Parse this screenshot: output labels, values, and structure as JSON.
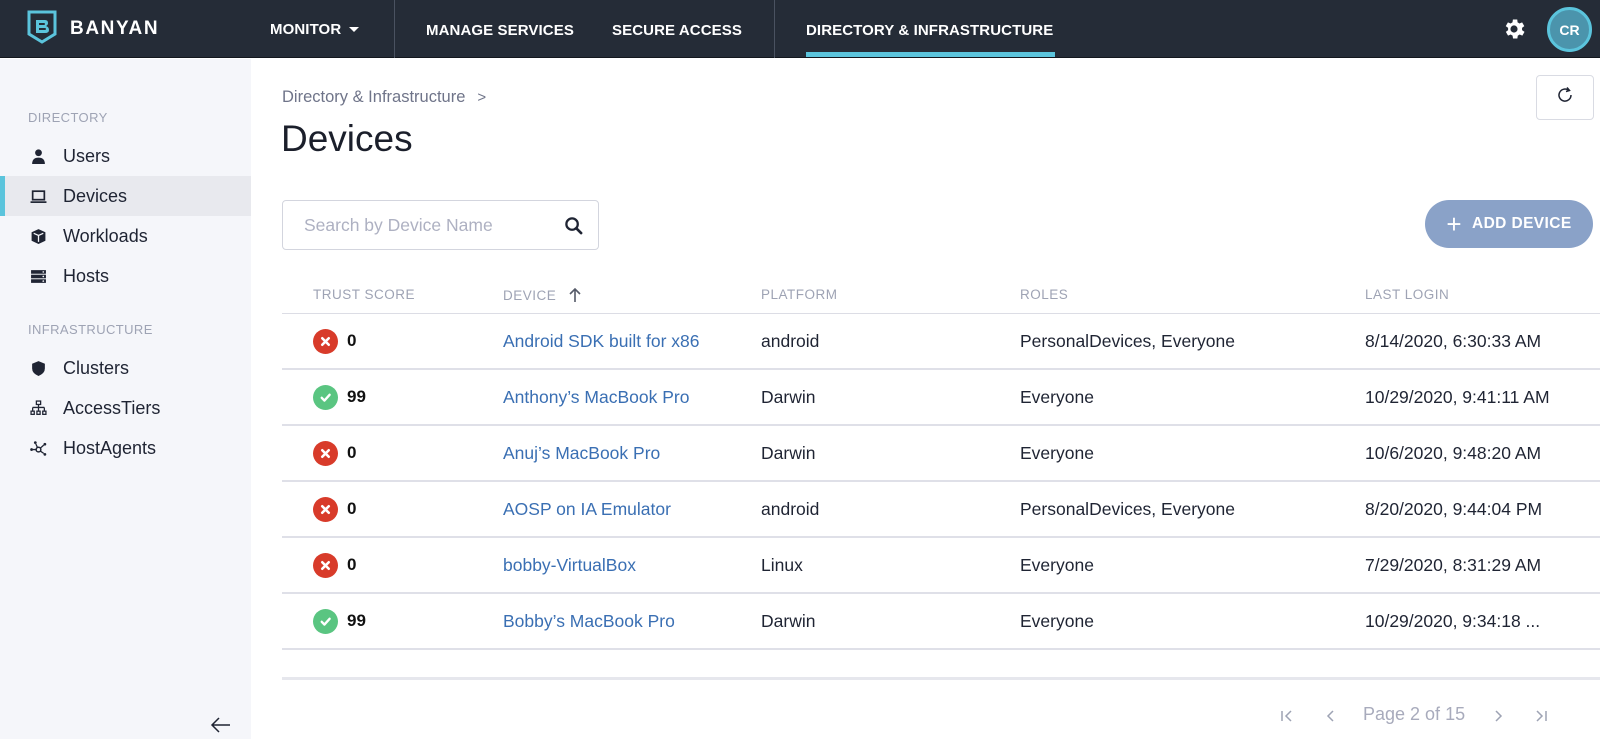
{
  "app": {
    "brand": "BANYAN",
    "accent_color": "#5bc4dc",
    "topbar_color": "#252c37"
  },
  "nav": {
    "monitor": "MONITOR",
    "manage_services": "MANAGE SERVICES",
    "secure_access": "SECURE ACCESS",
    "directory_infrastructure": "DIRECTORY & INFRASTRUCTURE",
    "active": "DIRECTORY & INFRASTRUCTURE"
  },
  "user": {
    "initials": "CR"
  },
  "sidebar": {
    "sections": [
      {
        "title": "DIRECTORY",
        "items": [
          {
            "label": "Users",
            "icon": "user-icon"
          },
          {
            "label": "Devices",
            "icon": "laptop-icon",
            "active": true
          },
          {
            "label": "Workloads",
            "icon": "cube-icon"
          },
          {
            "label": "Hosts",
            "icon": "server-icon"
          }
        ]
      },
      {
        "title": "INFRASTRUCTURE",
        "items": [
          {
            "label": "Clusters",
            "icon": "shield-icon"
          },
          {
            "label": "AccessTiers",
            "icon": "sitemap-icon"
          },
          {
            "label": "HostAgents",
            "icon": "network-icon"
          }
        ]
      }
    ]
  },
  "breadcrumb": {
    "parent": "Directory & Infrastructure",
    "separator": ">"
  },
  "page": {
    "title": "Devices"
  },
  "search": {
    "placeholder": "Search by Device Name",
    "value": ""
  },
  "actions": {
    "add_device": "ADD DEVICE",
    "add_device_color": "#8aa2c8"
  },
  "table": {
    "columns": [
      "TRUST SCORE",
      "DEVICE",
      "PLATFORM",
      "ROLES",
      "LAST LOGIN"
    ],
    "sort": {
      "column": "DEVICE",
      "direction": "ascending"
    },
    "rows": [
      {
        "status": "bad",
        "trust_score": "0",
        "device": "Android SDK built for x86",
        "platform": "android",
        "roles": "PersonalDevices, Everyone",
        "last_login": "8/14/2020, 6:30:33 AM"
      },
      {
        "status": "good",
        "trust_score": "99",
        "device": "Anthony’s MacBook Pro",
        "platform": "Darwin",
        "roles": "Everyone",
        "last_login": "10/29/2020, 9:41:11 AM"
      },
      {
        "status": "bad",
        "trust_score": "0",
        "device": "Anuj’s MacBook Pro",
        "platform": "Darwin",
        "roles": "Everyone",
        "last_login": "10/6/2020, 9:48:20 AM"
      },
      {
        "status": "bad",
        "trust_score": "0",
        "device": "AOSP on IA Emulator",
        "platform": "android",
        "roles": "PersonalDevices, Everyone",
        "last_login": "8/20/2020, 9:44:04 PM"
      },
      {
        "status": "bad",
        "trust_score": "0",
        "device": "bobby-VirtualBox",
        "platform": "Linux",
        "roles": "Everyone",
        "last_login": "7/29/2020, 8:31:29 AM"
      },
      {
        "status": "good",
        "trust_score": "99",
        "device": "Bobby’s MacBook Pro",
        "platform": "Darwin",
        "roles": "Everyone",
        "last_login": "10/29/2020, 9:34:18 ..."
      }
    ],
    "status_colors": {
      "bad": "#d83b2a",
      "good": "#5ac581"
    }
  },
  "pagination": {
    "label": "Page 2 of 15",
    "current_page": 2,
    "total_pages": 15
  }
}
